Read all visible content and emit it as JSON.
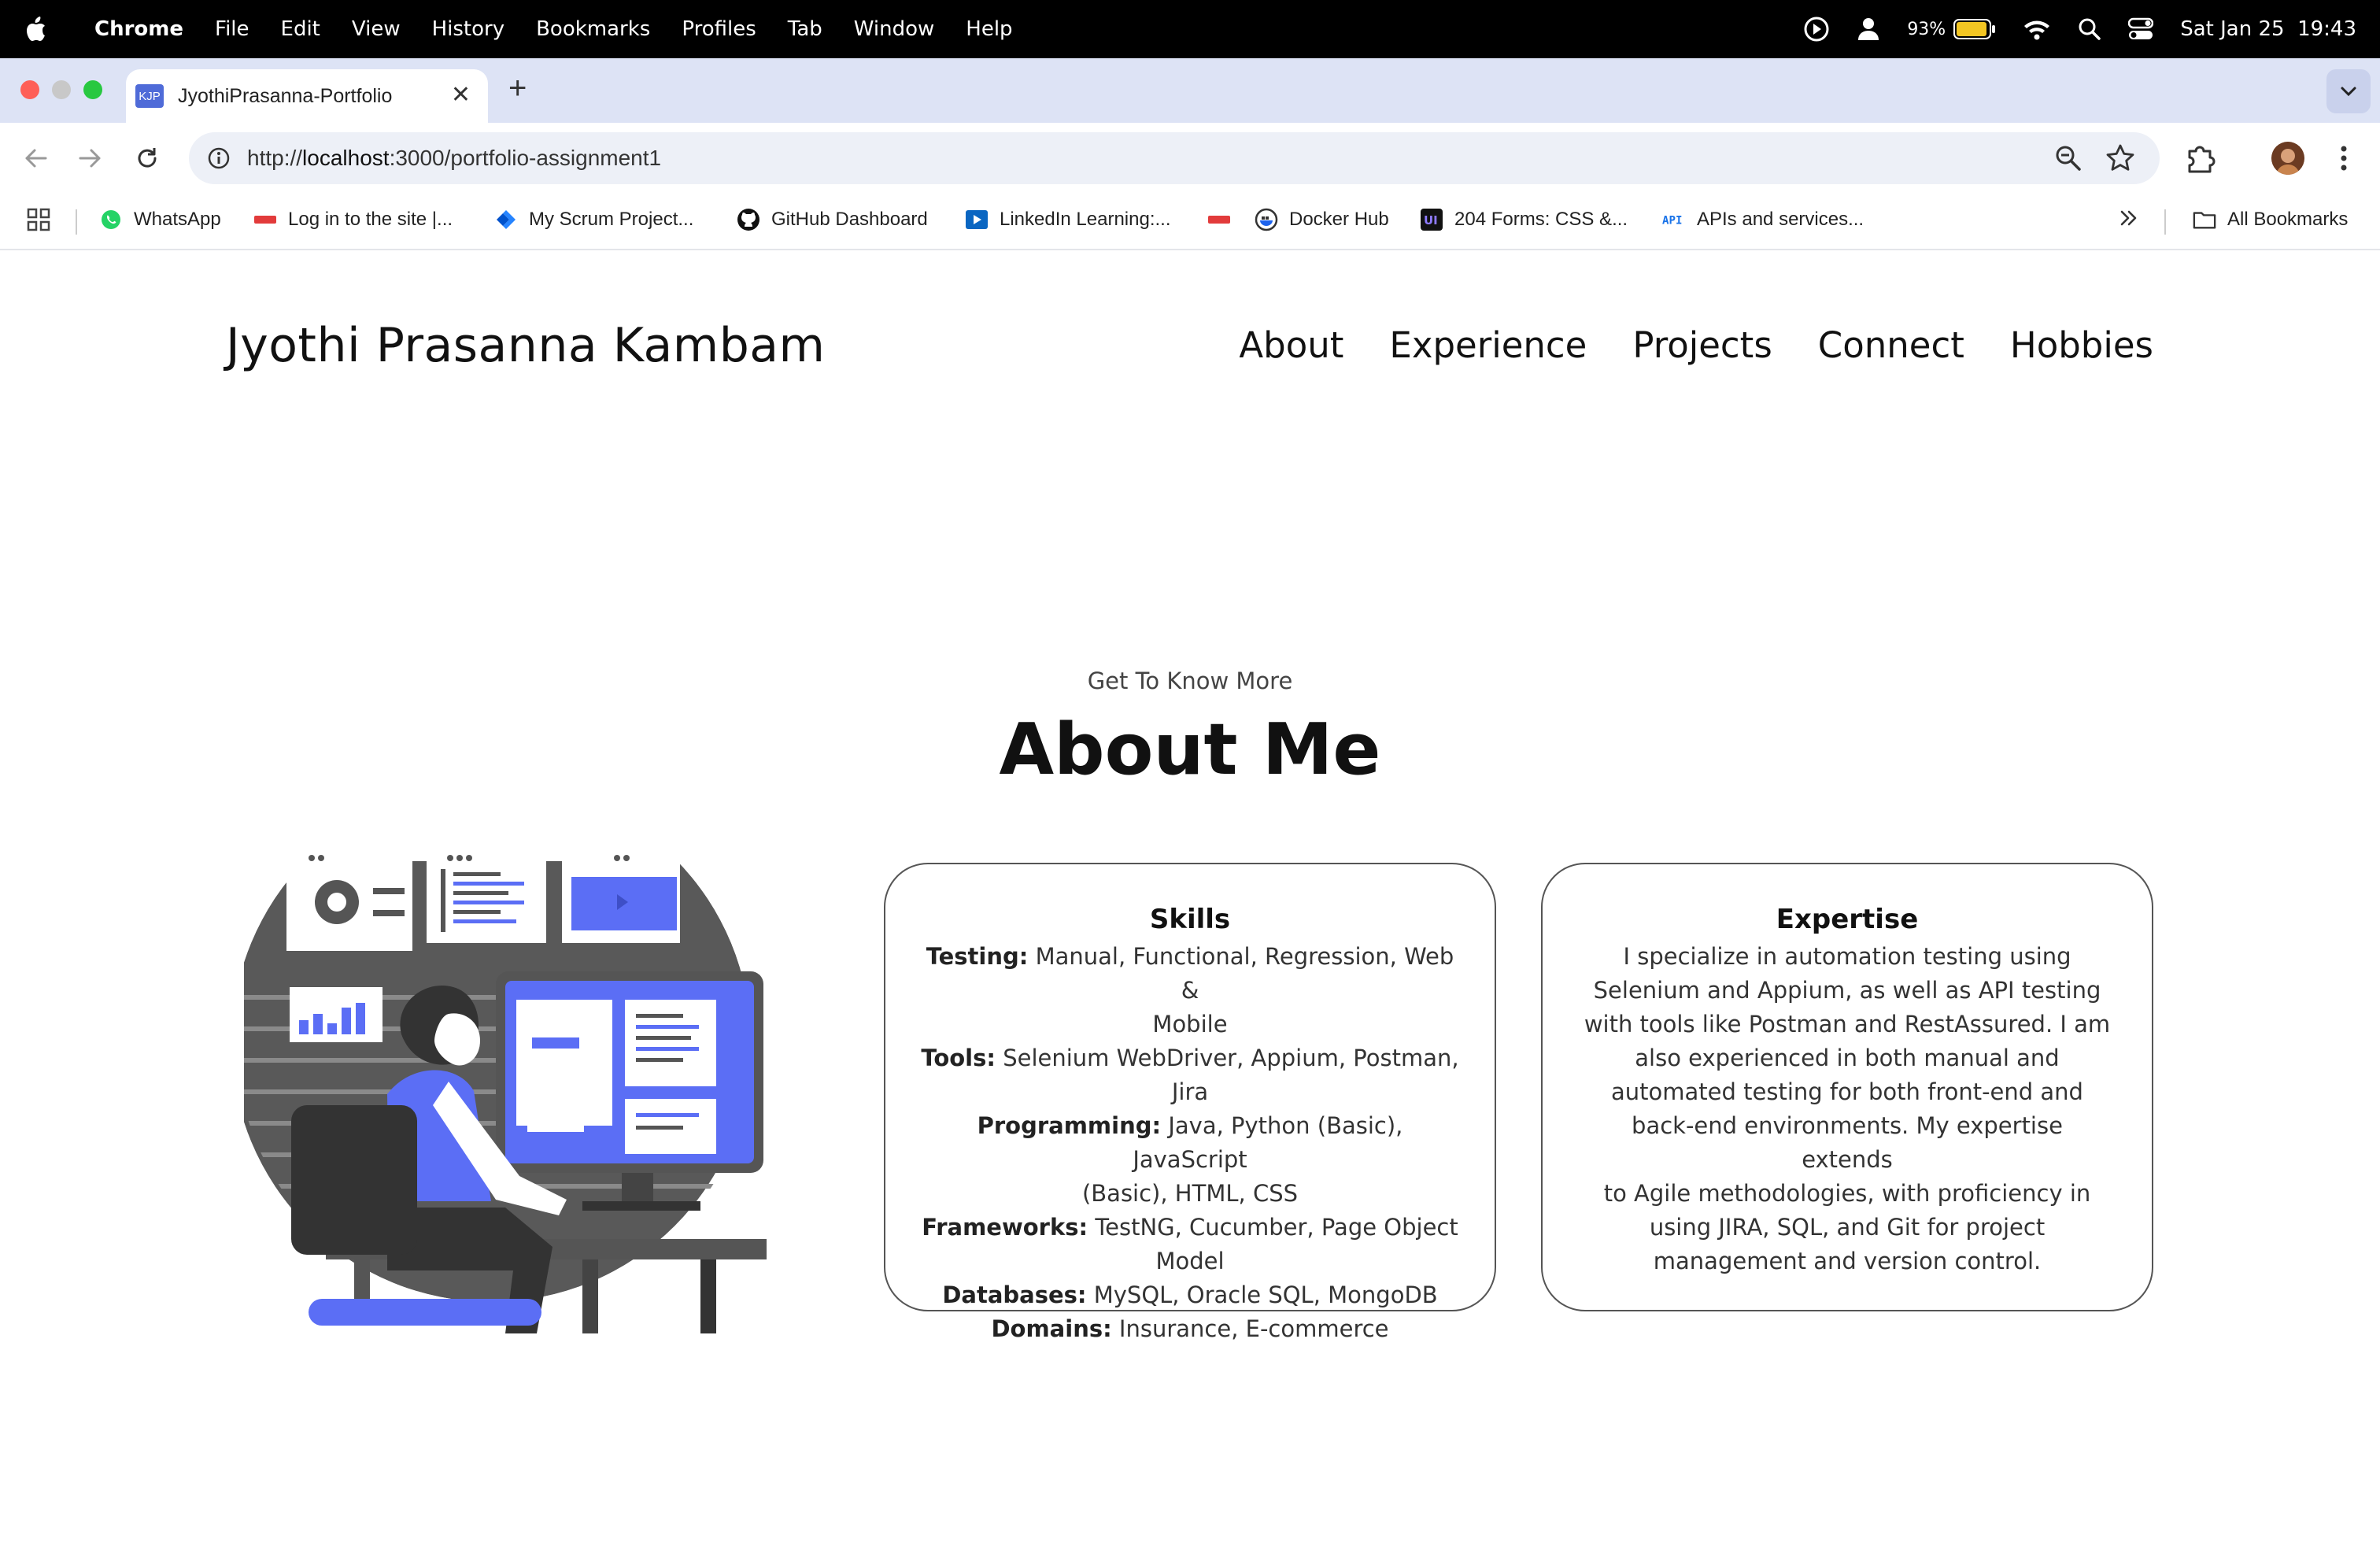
{
  "menubar": {
    "app_name": "Chrome",
    "items": [
      "File",
      "Edit",
      "View",
      "History",
      "Bookmarks",
      "Profiles",
      "Tab",
      "Window",
      "Help"
    ],
    "battery": "93%",
    "datetime": "Sat Jan 25  19:43"
  },
  "tab": {
    "favicon_text": "KJP",
    "title": "JyothiPrasanna-Portfolio"
  },
  "omnibox": {
    "url_scheme": "http://",
    "url_host": "localhost",
    "url_rest": ":3000/portfolio-assignment1"
  },
  "bookmarks": {
    "items": [
      "WhatsApp",
      "Log in to the site |...",
      "My Scrum Project...",
      "GitHub Dashboard",
      "LinkedIn Learning:...",
      "Docker Hub",
      "204 Forms: CSS &...",
      "APIs and services..."
    ],
    "all_label": "All Bookmarks"
  },
  "site": {
    "name": "Jyothi Prasanna Kambam",
    "nav": [
      "About",
      "Experience",
      "Projects",
      "Connect",
      "Hobbies"
    ]
  },
  "about": {
    "subtitle": "Get To Know More",
    "title": "About Me",
    "skills": {
      "heading": "Skills",
      "rows": [
        {
          "label": "Testing:",
          "lines": [
            "Manual, Functional, Regression, Web &",
            "Mobile"
          ]
        },
        {
          "label": "Tools:",
          "lines": [
            "Selenium WebDriver, Appium, Postman,",
            "Jira"
          ]
        },
        {
          "label": "Programming:",
          "lines": [
            "Java, Python (Basic), JavaScript",
            "(Basic), HTML, CSS"
          ]
        },
        {
          "label": "Frameworks:",
          "lines": [
            "TestNG, Cucumber, Page Object",
            "Model"
          ]
        },
        {
          "label": "Databases:",
          "lines": [
            "MySQL, Oracle SQL, MongoDB"
          ]
        },
        {
          "label": "Domains:",
          "lines": [
            "Insurance, E-commerce"
          ]
        }
      ]
    },
    "expertise": {
      "heading": "Expertise",
      "lines": [
        "I specialize in automation testing using",
        "Selenium and Appium, as well as API testing",
        "with tools like Postman and RestAssured. I am",
        "also experienced in both manual and",
        "automated testing for both front-end and",
        "back-end environments. My expertise extends",
        "to Agile methodologies, with proficiency in",
        "using JIRA, SQL, and Git for project",
        "management and version control."
      ]
    }
  },
  "colors": {
    "accent": "#5b6ef5",
    "tabstrip": "#dde3f5"
  }
}
